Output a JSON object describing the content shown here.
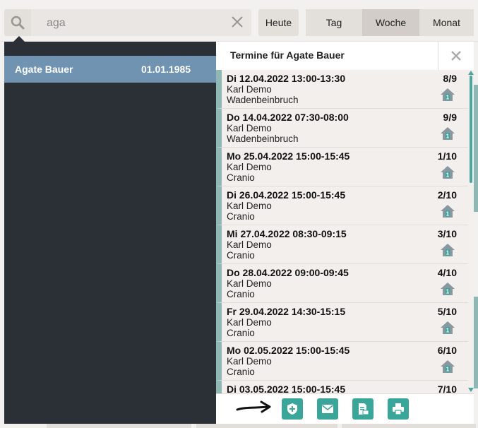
{
  "toolbar": {
    "search_value": "aga",
    "today_label": "Heute",
    "view_tabs": [
      {
        "label": "Tag"
      },
      {
        "label": "Woche",
        "active": true
      },
      {
        "label": "Monat"
      }
    ]
  },
  "search_results": [
    {
      "name": "Agate Bauer",
      "dob": "01.01.1985"
    }
  ],
  "appointments_panel": {
    "title": "Termine für Agate Bauer",
    "appointments": [
      {
        "date": "Di 12.04.2022 13:00-13:30",
        "therapist": "Karl Demo",
        "treatment": "Wadenbeinbruch",
        "count": "8/9",
        "icon": "home-visit-icon"
      },
      {
        "date": "Do 14.04.2022 07:30-08:00",
        "therapist": "Karl Demo",
        "treatment": "Wadenbeinbruch",
        "count": "9/9",
        "icon": "home-visit-icon"
      },
      {
        "date": "Mo 25.04.2022 15:00-15:45",
        "therapist": "Karl Demo",
        "treatment": "Cranio",
        "count": "1/10",
        "icon": "home-visit-icon"
      },
      {
        "date": "Di 26.04.2022 15:00-15:45",
        "therapist": "Karl Demo",
        "treatment": "Cranio",
        "count": "2/10",
        "icon": "home-visit-icon"
      },
      {
        "date": "Mi 27.04.2022 08:30-09:15",
        "therapist": "Karl Demo",
        "treatment": "Cranio",
        "count": "3/10",
        "icon": "home-visit-icon"
      },
      {
        "date": "Do 28.04.2022 09:00-09:45",
        "therapist": "Karl Demo",
        "treatment": "Cranio",
        "count": "4/10",
        "icon": "home-visit-icon"
      },
      {
        "date": "Fr 29.04.2022 14:30-15:15",
        "therapist": "Karl Demo",
        "treatment": "Cranio",
        "count": "5/10",
        "icon": "home-visit-icon"
      },
      {
        "date": "Mo 02.05.2022 15:00-15:45",
        "therapist": "Karl Demo",
        "treatment": "Cranio",
        "count": "6/10",
        "icon": "home-visit-icon"
      },
      {
        "date": "Di 03.05.2022 15:00-15:45",
        "therapist": "",
        "treatment": "",
        "count": "7/10",
        "icon": ""
      }
    ],
    "footer_icons": [
      "new-prescription-icon",
      "email-icon",
      "document-icon",
      "print-icon"
    ]
  },
  "colors": {
    "accent": "#3aa69a",
    "selected_row": "#6f93b0",
    "dark_panel": "#2b3036",
    "appointment_stripe": "#8fb8b4"
  }
}
